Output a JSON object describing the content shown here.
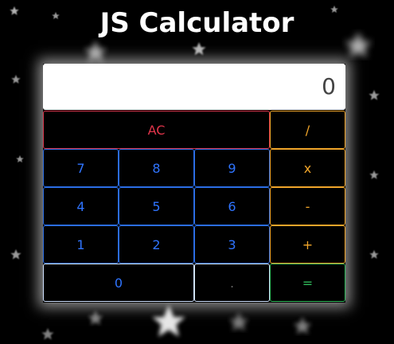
{
  "title": "JS Calculator",
  "display": {
    "value": "0"
  },
  "keys": {
    "clear": "AC",
    "divide": "/",
    "multiply": "x",
    "subtract": "-",
    "add": "+",
    "equals": "=",
    "decimal": ".",
    "seven": "7",
    "eight": "8",
    "nine": "9",
    "four": "4",
    "five": "5",
    "six": "6",
    "one": "1",
    "two": "2",
    "three": "3",
    "zero": "0"
  },
  "colors": {
    "background": "#000000",
    "number_key": "#2f74ff",
    "clear_key": "#e0344a",
    "operator_key": "#f2a62a",
    "equals_key": "#2fb85a"
  }
}
